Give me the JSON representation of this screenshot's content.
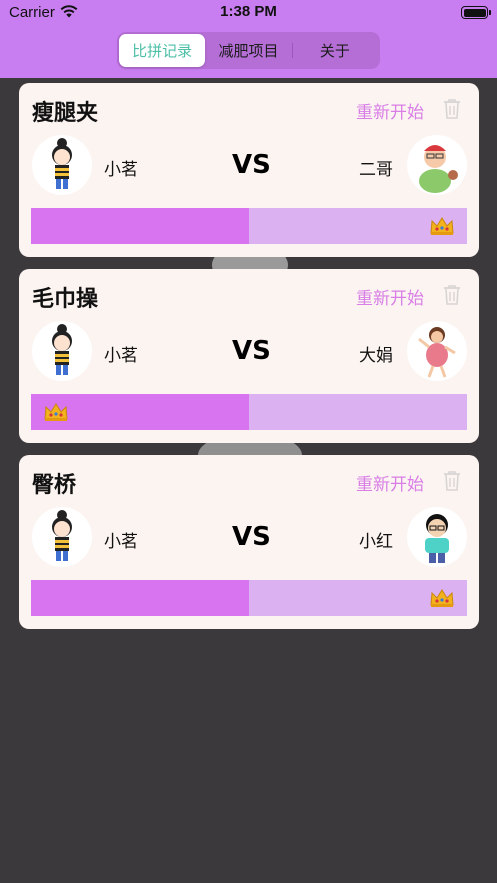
{
  "status": {
    "carrier": "Carrier",
    "time": "1:38 PM"
  },
  "tabs": [
    {
      "label": "比拼记录",
      "active": true
    },
    {
      "label": "减肥项目",
      "active": false
    },
    {
      "label": "关于",
      "active": false
    }
  ],
  "colors": {
    "header": "#c87ef0",
    "accent": "#d874ef",
    "bar_bg": "#dcb1f1",
    "active_tab_text": "#4dbfa7",
    "restart_text": "#d97ee6"
  },
  "cards": [
    {
      "title": "瘦腿夹",
      "restart_label": "重新开始",
      "trash_icon": "trash-icon",
      "left_player": {
        "name": "小茗",
        "avatar": "girl-bun-avatar"
      },
      "vs_label": "VS",
      "right_player": {
        "name": "二哥",
        "avatar": "chubby-guy-avatar"
      },
      "left_progress": 0.5,
      "winner": "right"
    },
    {
      "title": "毛巾操",
      "restart_label": "重新开始",
      "trash_icon": "trash-icon",
      "left_player": {
        "name": "小茗",
        "avatar": "girl-bun-avatar"
      },
      "vs_label": "VS",
      "right_player": {
        "name": "大娟",
        "avatar": "dancing-lady-avatar"
      },
      "left_progress": 0.5,
      "winner": "left"
    },
    {
      "title": "臀桥",
      "restart_label": "重新开始",
      "trash_icon": "trash-icon",
      "left_player": {
        "name": "小茗",
        "avatar": "girl-bun-avatar"
      },
      "vs_label": "VS",
      "right_player": {
        "name": "小红",
        "avatar": "boy-glasses-avatar"
      },
      "left_progress": 0.5,
      "winner": "right"
    }
  ]
}
